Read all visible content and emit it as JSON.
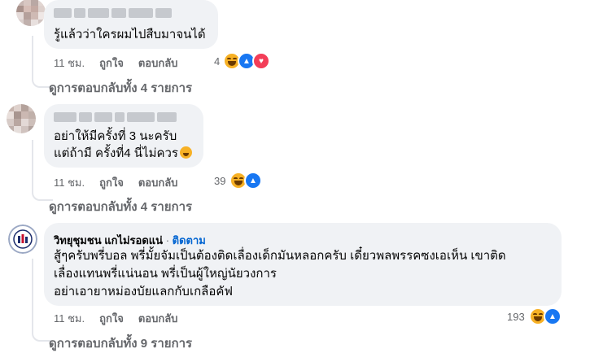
{
  "comments": [
    {
      "text": "รู้แล้วว่าใครผมไปสืบมาจนได้",
      "time": "11 ชม.",
      "like": "ถูกใจ",
      "reply": "ตอบกลับ",
      "reaction_count": "4",
      "reactions": [
        "haha-icon",
        "like-icon",
        "love-icon"
      ],
      "view_replies": "ดูการตอบกลับทั้ง 4 รายการ"
    },
    {
      "text_line1": "อย่าให้มีครั้งที่ 3 นะครับ",
      "text_line2": "แต่ถ้ามี ครั้งที่4 นี่ไม่ควร",
      "time": "11 ชม.",
      "like": "ถูกใจ",
      "reply": "ตอบกลับ",
      "reaction_count": "39",
      "reactions": [
        "haha-icon",
        "like-icon"
      ],
      "view_replies": "ดูการตอบกลับทั้ง 4 รายการ"
    },
    {
      "author": "วิทยุชุมชน แกไม่รอดแน่",
      "separator": "·",
      "follow": "ติดตาม",
      "text_line1": "สู้ๆครับพรี่บอล พรี่มั้ยจัมเป็นต้องติดเลื่องเด็กมันหลอกครับ เดี๋ยวพลพรรคซงเอเห็น เขาติด",
      "text_line2": "เลื่องแทนพรี่แน่นอน พรี่เป็นผู้ใหญ่นัยวงการ",
      "text_line3": "อย่าเอายาหม่องบัยแลกกับเกลือคัฟ",
      "time": "11 ชม.",
      "like": "ถูกใจ",
      "reply": "ตอบกลับ",
      "reaction_count": "193",
      "reactions": [
        "haha-icon",
        "like-icon"
      ],
      "view_replies": "ดูการตอบกลับทั้ง 9 รายการ"
    }
  ],
  "colors": {
    "bubble": "#f0f2f5",
    "muted": "#65676b",
    "link": "#0064d1",
    "haha": "#f7b125",
    "like": "#1877f2",
    "love": "#f33e58"
  }
}
